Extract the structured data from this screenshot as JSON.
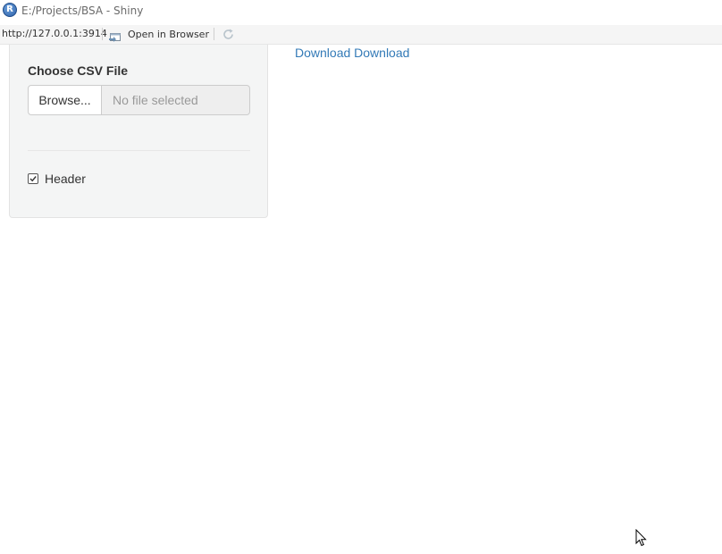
{
  "window": {
    "title": "E:/Projects/BSA - Shiny",
    "app_icon_letter": "R"
  },
  "addressbar": {
    "url": "http://127.0.0.1:3914",
    "open_in_browser_label": "Open in Browser"
  },
  "sidebar": {
    "file_input_label": "Choose CSV File",
    "browse_button_label": "Browse...",
    "file_field_text": "No file selected",
    "header_checkbox_label": "Header",
    "header_checked": true
  },
  "main": {
    "download_link_label": "Download Download"
  },
  "colors": {
    "link": "#337ab7",
    "well_background": "#f4f5f5"
  }
}
